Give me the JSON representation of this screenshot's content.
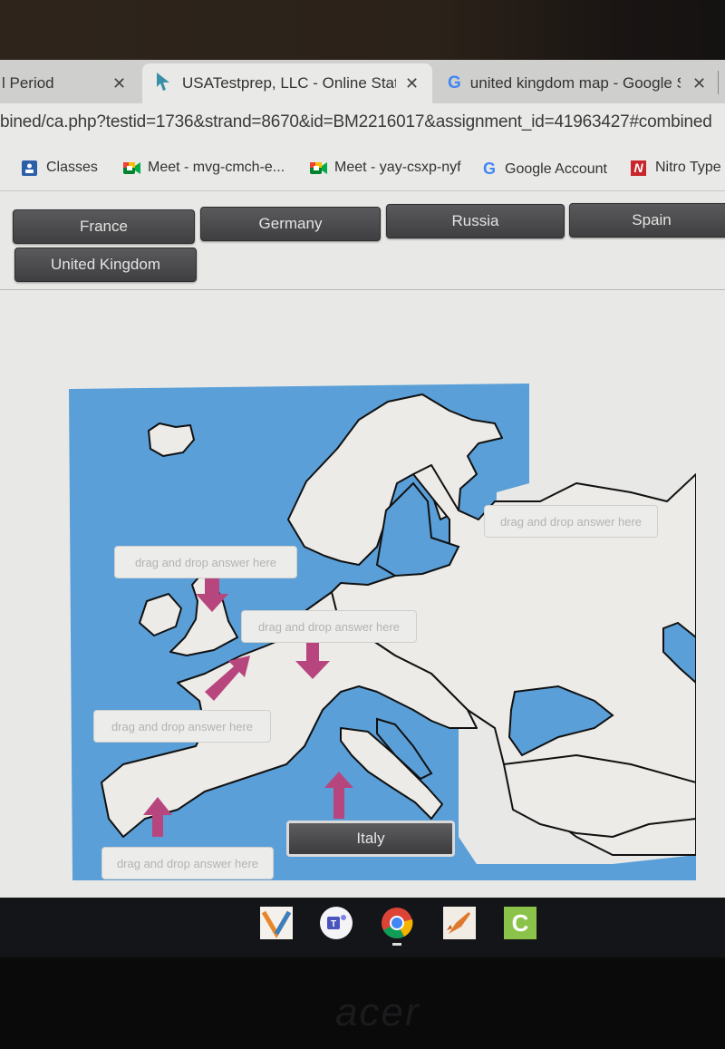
{
  "browser": {
    "tabs": [
      {
        "title": "l Period",
        "state": "inactive",
        "icon": "none"
      },
      {
        "title": "USATestprep, LLC - Online State",
        "state": "active",
        "icon": "usatestprep-arrow-icon"
      },
      {
        "title": "united kingdom map - Google S",
        "state": "inactive",
        "icon": "google-g-icon"
      }
    ],
    "tab_close_glyph": "✕",
    "url": "bined/ca.php?testid=1736&strand=8670&id=BM2216017&assignment_id=41963427#combined",
    "bookmarks": [
      {
        "label": "Classes",
        "icon": "google-classroom-icon"
      },
      {
        "label": "Meet - mvg-cmch-e...",
        "icon": "google-meet-icon"
      },
      {
        "label": "Meet - yay-csxp-nyf",
        "icon": "google-meet-icon"
      },
      {
        "label": "Google Account",
        "icon": "google-g-icon"
      },
      {
        "label": "Nitro Type",
        "icon": "nitro-type-icon"
      }
    ]
  },
  "quiz": {
    "answer_bank": [
      "France",
      "Germany",
      "Russia",
      "Spain",
      "United Kingdom"
    ],
    "drop_placeholder": "drag and drop answer here",
    "drop_zones": [
      {
        "target": "United Kingdom arrow",
        "value": ""
      },
      {
        "target": "Germany arrow",
        "value": ""
      },
      {
        "target": "Russia region",
        "value": ""
      },
      {
        "target": "France arrow",
        "value": ""
      },
      {
        "target": "Spain arrow",
        "value": ""
      },
      {
        "target": "Italy arrow",
        "value": "Italy"
      }
    ],
    "placed_answer": "Italy",
    "colors": {
      "sea": "#5a9fd8",
      "land": "#ecebe8",
      "arrow": "#b8467e",
      "button": "#4a4a4c"
    }
  },
  "taskbar": {
    "apps": [
      {
        "name": "vocabulary-app-icon",
        "glyph": "V"
      },
      {
        "name": "microsoft-teams-icon",
        "glyph": "T"
      },
      {
        "name": "chrome-icon",
        "glyph": ""
      },
      {
        "name": "rocket-app-icon",
        "glyph": ""
      },
      {
        "name": "c-app-icon",
        "glyph": "C"
      }
    ]
  },
  "device": {
    "brand": "acer"
  }
}
